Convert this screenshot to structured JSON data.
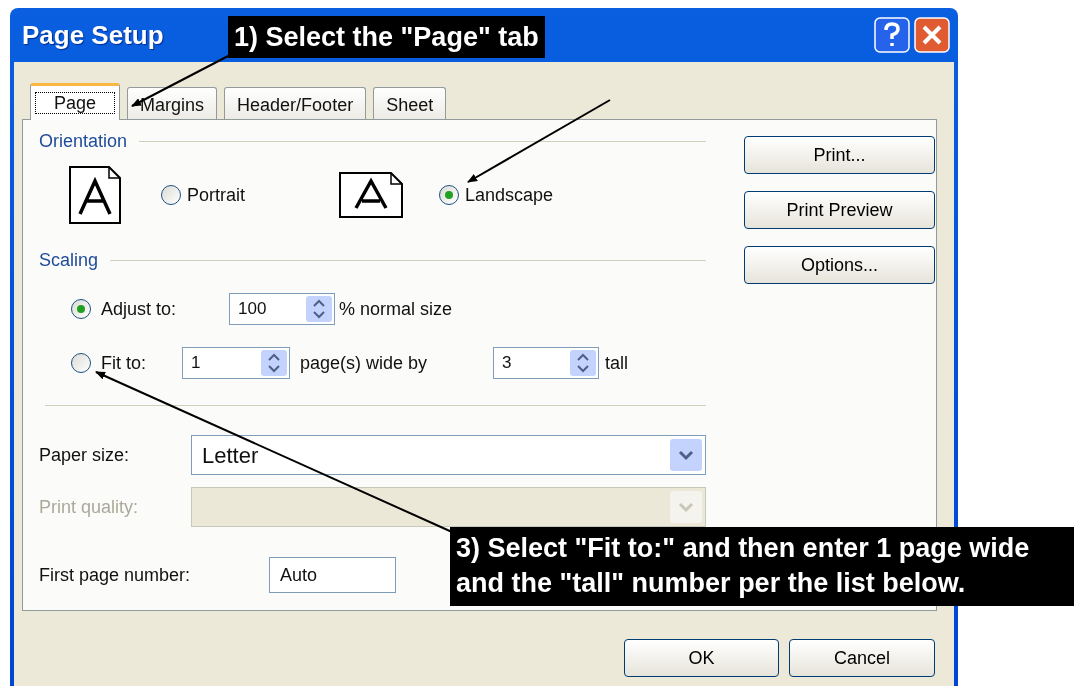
{
  "window": {
    "title": "Page Setup"
  },
  "tabs": [
    {
      "label": "Page",
      "selected": true
    },
    {
      "label": "Margins",
      "selected": false
    },
    {
      "label": "Header/Footer",
      "selected": false
    },
    {
      "label": "Sheet",
      "selected": false
    }
  ],
  "orientation": {
    "label": "Orientation",
    "options": [
      {
        "label": "Portrait",
        "selected": false
      },
      {
        "label": "Landscape",
        "selected": true
      }
    ]
  },
  "scaling": {
    "label": "Scaling",
    "options": [
      {
        "kind": "adjust",
        "label": "Adjust to:",
        "selected": true,
        "value": "100",
        "suffix": "% normal size"
      },
      {
        "kind": "fit",
        "label": "Fit to:",
        "selected": false,
        "wide_value": "1",
        "wide_suffix": "page(s) wide by",
        "tall_value": "3",
        "tall_suffix": "tall"
      }
    ]
  },
  "paper_size": {
    "label": "Paper size:",
    "value": "Letter"
  },
  "print_quality": {
    "label": "Print quality:",
    "disabled": true
  },
  "first_page_number": {
    "label": "First page number:",
    "value": "Auto"
  },
  "side_buttons": [
    "Print...",
    "Print Preview",
    "Options..."
  ],
  "footer_buttons": [
    "OK",
    "Cancel"
  ],
  "annotations": [
    {
      "text": "1) Select the \"Page\" tab"
    },
    {
      "text": "3) Select \"Fit to:\" and then enter 1 page wide and the \"tall\" number per the list below."
    }
  ]
}
